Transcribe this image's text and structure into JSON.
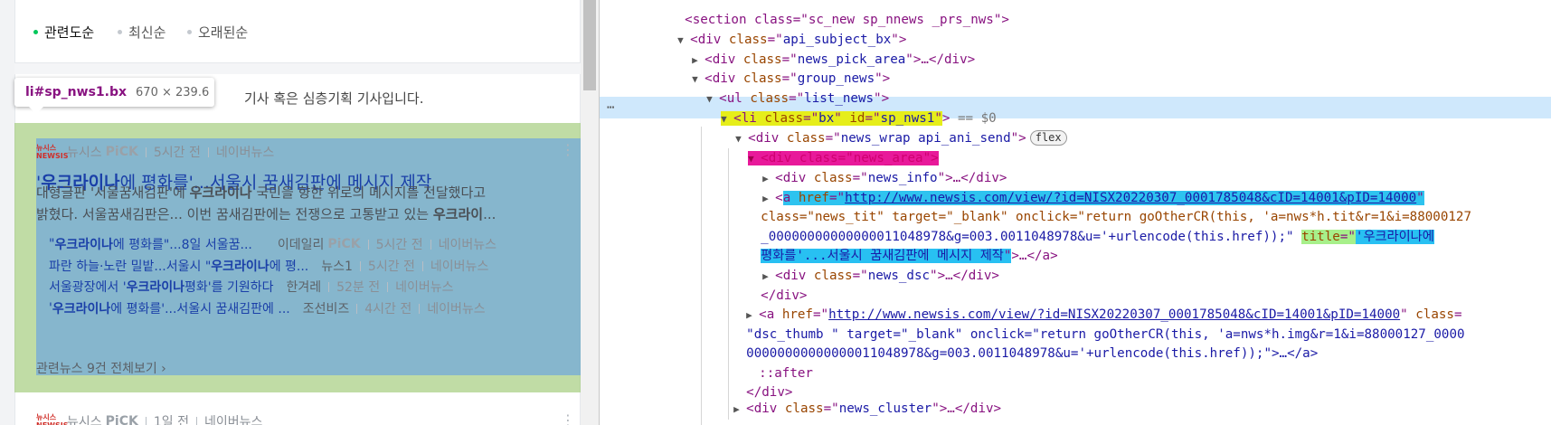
{
  "sort": {
    "options": [
      "관련도순",
      "최신순",
      "오래된순"
    ],
    "active_index": 0
  },
  "tooltip": {
    "selector": "li#sp_nws1.bx",
    "dimensions": "670 × 239.6"
  },
  "notice": "기사 혹은 심층기획 기사입니다.",
  "news": {
    "press": "뉴시스",
    "pick": "PiCK",
    "time": "5시간 전",
    "source": "네이버뉴스",
    "title_keyword": "우크라이나",
    "title_rest": "에 평화를'...서울시 꿈새김판에 메시지 제작",
    "title_open_quote": "'",
    "desc_line1_a": "대형글판 '서울꿈새김판'에 ",
    "desc_line1_kw": "우크라이나",
    "desc_line1_b": " 국민을 향한 위로의 메시지를 전달했다고",
    "desc_line2_a": "밝혔다. 서울꿈새김판은... 이번 꿈새김판에는 전쟁으로 고통받고 있는 ",
    "desc_line2_kw": "우크라이",
    "desc_line2_b": "...",
    "clusters": [
      {
        "pre": "\"",
        "kw": "우크라이나",
        "post": "에 평화를\"...8일 서울꿈...",
        "src": "이데일리",
        "pick": "PiCK",
        "time": "5시간 전",
        "naver": "네이버뉴스"
      },
      {
        "pre": "파란 하늘·노란 밀밭...서울시 \"",
        "kw": "우크라이나",
        "post": "에 평...",
        "src": "뉴스1",
        "pick": "",
        "time": "5시간 전",
        "naver": "네이버뉴스"
      },
      {
        "pre": "서울광장에서 '",
        "kw": "우크라이나",
        "post": " 평화'를 기원하다",
        "src": "한겨레",
        "pick": "",
        "time": "52분 전",
        "naver": "네이버뉴스"
      },
      {
        "pre": "'",
        "kw": "우크라이나",
        "post": "에 평화를'...서울시 꿈새김판에 ...",
        "src": "조선비즈",
        "pick": "",
        "time": "4시간 전",
        "naver": "네이버뉴스"
      }
    ],
    "more_link": "관련뉴스 9건 전체보기 ›",
    "next_press": "뉴시스",
    "next_pick": "PiCK",
    "next_time": "1일 전",
    "next_source": "네이버뉴스"
  },
  "devtools": {
    "l0": {
      "prefix": "<section class=\"sc_new sp_nnews _prs_nws\">",
      "suffix": ""
    },
    "l1_tag": "div",
    "l1_attr": "class",
    "l1_val": "api_subject_bx",
    "l2_tag": "div",
    "l2_attr": "class",
    "l2_val": "news_pick_area",
    "l2_tail": "…</div>",
    "l3_tag": "div",
    "l3_attr": "class",
    "l3_val": "group_news",
    "l4_tag": "ul",
    "l4_attr": "class",
    "l4_val": "list_news",
    "l5_tag": "li",
    "l5_attr1": "class",
    "l5_val1": "bx",
    "l5_attr2": "id",
    "l5_val2": "sp_nws1",
    "l5_tail": " == $0",
    "l6_tag": "div",
    "l6_attr": "class",
    "l6_val": "news_wrap api_ani_send",
    "l6_badge": "flex",
    "l7_tag": "div",
    "l7_attr": "class",
    "l7_val": "news_area",
    "l8_tag": "div",
    "l8_attr": "class",
    "l8_val": "news_info",
    "l8_tail": "…</div>",
    "l9_tag": "a",
    "l9_attr": "href",
    "l9_href": "http://www.newsis.com/view/?id=NISX20220307_0001785048&cID=14001&pID=14000",
    "l10_text": "class=\"news_tit\" target=\"_blank\" onclick=\"return goOtherCR(this, 'a=nws*h.tit&r=1&i=88000127",
    "l11_text": "_00000000000000011048978&g=003.0011048978&u='+urlencode(this.href));\"",
    "l11_title_attr": "title",
    "l11_title_val": "'우크라이나에",
    "l12_title_val": "평화를'...서울시 꿈새김판에 메시지 제작",
    "l12_tail": ">…</a>",
    "l13_tag": "div",
    "l13_attr": "class",
    "l13_val": "news_dsc",
    "l13_tail": "…</div>",
    "l14_text": "</div>",
    "l15_tag": "a",
    "l15_attr": "href",
    "l15_href": "http://www.newsis.com/view/?id=NISX20220307_0001785048&cID=14001&pID=14000",
    "l15_attr2": "class",
    "l16_text": "\"dsc_thumb \" target=\"_blank\" onclick=\"return goOtherCR(this, 'a=nws*h.img&r=1&i=88000127_0000",
    "l17_text": "00000000000000011048978&g=003.0011048978&u='+urlencode(this.href));\">…</a>",
    "l18_text": "::after",
    "l19_text": "</div>",
    "l20_tag": "div",
    "l20_attr": "class",
    "l20_val": "news_cluster",
    "l20_tail": "…</div>"
  }
}
